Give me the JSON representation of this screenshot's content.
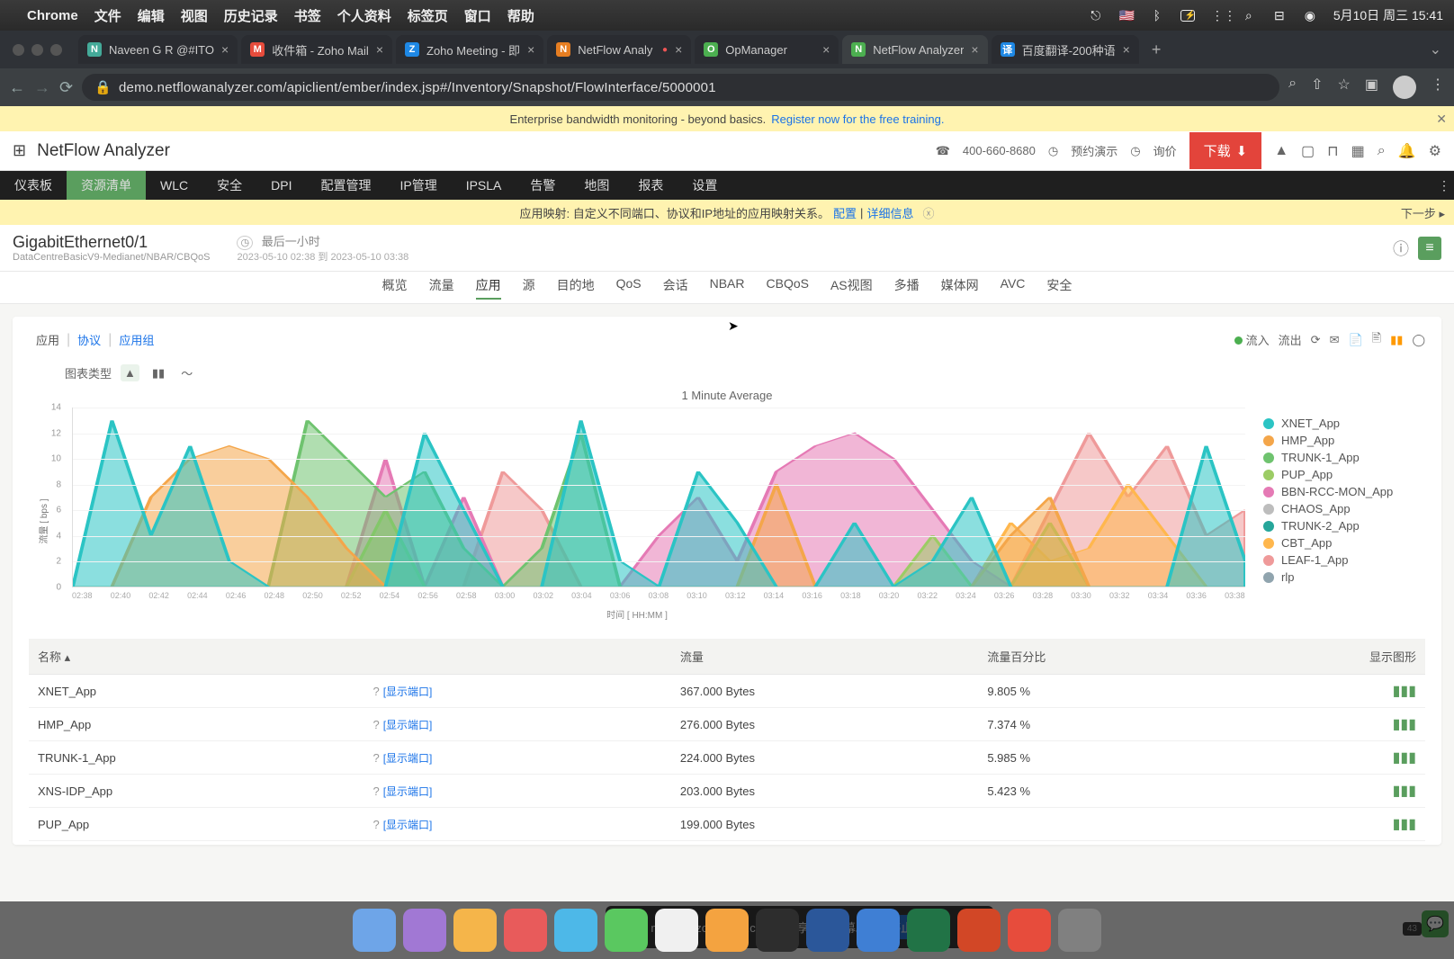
{
  "menubar": {
    "apple": "",
    "appname": "Chrome",
    "items": [
      "文件",
      "编辑",
      "视图",
      "历史记录",
      "书签",
      "个人资料",
      "标签页",
      "窗口",
      "帮助"
    ],
    "datetime": "5月10日 周三 15:41"
  },
  "tabs": [
    {
      "title": "Naveen G R @#ITO",
      "favi": "#4a9",
      "fl": "N"
    },
    {
      "title": "收件箱 - Zoho Mail",
      "favi": "#e74c3c",
      "fl": "M"
    },
    {
      "title": "Zoho Meeting - 即",
      "favi": "#1e88e5",
      "fl": "Z"
    },
    {
      "title": "NetFlow Analy",
      "favi": "#e67e22",
      "fl": "N",
      "rec": true
    },
    {
      "title": "OpManager",
      "favi": "#4caf50",
      "fl": "O"
    },
    {
      "title": "NetFlow Analyzer",
      "favi": "#4caf50",
      "fl": "N",
      "active": true
    },
    {
      "title": "百度翻译-200种语",
      "favi": "#1e88e5",
      "fl": "译"
    }
  ],
  "url": "demo.netflowanalyzer.com/apiclient/ember/index.jsp#/Inventory/Snapshot/FlowInterface/5000001",
  "banner1": {
    "text": "Enterprise bandwidth monitoring - beyond basics.",
    "link": "Register now for the free training."
  },
  "appheader": {
    "title": "NetFlow Analyzer",
    "phone": "400-660-8680",
    "demo": "预约演示",
    "quote": "询价",
    "download": "下载"
  },
  "topnav": [
    "仪表板",
    "资源清单",
    "WLC",
    "安全",
    "DPI",
    "配置管理",
    "IP管理",
    "IPSLA",
    "告警",
    "地图",
    "报表",
    "设置"
  ],
  "topnav_active": 1,
  "banner2": {
    "text": "应用映射: 自定义不同端口、协议和IP地址的应用映射关系。",
    "link1": "配置",
    "link2": "详细信息",
    "next": "下一步 ▸"
  },
  "interface": {
    "name": "GigabitEthernet0/1",
    "sub": "DataCentreBasicV9-Medianet/NBAR/CBQoS",
    "timelabel": "最后一小时",
    "range": "2023-05-10 02:38 到 2023-05-10 03:38"
  },
  "subnav": [
    "概览",
    "流量",
    "应用",
    "源",
    "目的地",
    "QoS",
    "会话",
    "NBAR",
    "CBQoS",
    "AS视图",
    "多播",
    "媒体网",
    "AVC",
    "安全"
  ],
  "subnav_active": 2,
  "filter": {
    "tabs": [
      "应用",
      "协议",
      "应用组"
    ],
    "in": "流入",
    "out": "流出"
  },
  "chart_type_label": "图表类型",
  "chart_data": {
    "type": "area",
    "title": "1 Minute Average",
    "xlabel": "时间 [ HH:MM ]",
    "ylabel": "流量 [ bps ]",
    "ylim": [
      0,
      14
    ],
    "yticks": [
      0,
      2,
      4,
      6,
      8,
      10,
      12,
      14
    ],
    "categories": [
      "02:38",
      "02:40",
      "02:42",
      "02:44",
      "02:46",
      "02:48",
      "02:50",
      "02:52",
      "02:54",
      "02:56",
      "02:58",
      "03:00",
      "03:02",
      "03:04",
      "03:06",
      "03:08",
      "03:10",
      "03:12",
      "03:14",
      "03:16",
      "03:18",
      "03:20",
      "03:22",
      "03:24",
      "03:26",
      "03:28",
      "03:30",
      "03:32",
      "03:34",
      "03:36",
      "03:38"
    ],
    "series": [
      {
        "name": "XNET_App",
        "color": "#2bc4c4",
        "values": [
          0,
          13,
          4,
          11,
          2,
          0,
          0,
          0,
          0,
          12,
          6,
          0,
          0,
          13,
          2,
          0,
          9,
          5,
          0,
          0,
          5,
          0,
          2,
          7,
          0,
          0,
          0,
          0,
          0,
          11,
          2
        ]
      },
      {
        "name": "HMP_App",
        "color": "#f4a64a",
        "values": [
          0,
          0,
          7,
          10,
          11,
          10,
          7,
          3,
          0,
          0,
          0,
          0,
          0,
          0,
          0,
          0,
          0,
          0,
          8,
          0,
          0,
          0,
          0,
          0,
          4,
          7,
          0,
          0,
          0,
          0,
          0
        ]
      },
      {
        "name": "TRUNK-1_App",
        "color": "#6fc36f",
        "values": [
          0,
          0,
          0,
          0,
          0,
          0,
          13,
          10,
          7,
          9,
          3,
          0,
          3,
          12,
          0,
          0,
          0,
          0,
          0,
          0,
          0,
          0,
          0,
          0,
          0,
          0,
          0,
          0,
          0,
          0,
          0
        ]
      },
      {
        "name": "PUP_App",
        "color": "#9ccc65",
        "values": [
          0,
          0,
          0,
          0,
          0,
          0,
          0,
          0,
          6,
          0,
          0,
          0,
          0,
          0,
          0,
          0,
          0,
          0,
          0,
          0,
          0,
          0,
          4,
          0,
          0,
          5,
          0,
          0,
          0,
          0,
          0
        ]
      },
      {
        "name": "BBN-RCC-MON_App",
        "color": "#e57ab5",
        "values": [
          0,
          0,
          0,
          0,
          0,
          0,
          0,
          0,
          10,
          0,
          7,
          0,
          0,
          0,
          0,
          4,
          7,
          2,
          9,
          11,
          12,
          10,
          6,
          2,
          0,
          0,
          0,
          0,
          0,
          0,
          0
        ]
      },
      {
        "name": "CHAOS_App",
        "color": "#bdbdbd",
        "values": [
          0,
          0,
          0,
          0,
          0,
          0,
          0,
          0,
          0,
          0,
          0,
          0,
          0,
          0,
          0,
          0,
          0,
          0,
          0,
          0,
          0,
          0,
          0,
          0,
          0,
          0,
          0,
          0,
          0,
          0,
          0
        ]
      },
      {
        "name": "TRUNK-2_App",
        "color": "#26a69a",
        "values": [
          0,
          0,
          0,
          0,
          0,
          0,
          0,
          0,
          0,
          0,
          0,
          0,
          0,
          0,
          0,
          0,
          0,
          0,
          0,
          0,
          0,
          0,
          0,
          0,
          0,
          0,
          0,
          0,
          0,
          0,
          0
        ]
      },
      {
        "name": "CBT_App",
        "color": "#ffb74d",
        "values": [
          0,
          0,
          0,
          0,
          0,
          0,
          0,
          0,
          0,
          0,
          0,
          0,
          0,
          0,
          0,
          0,
          0,
          0,
          0,
          0,
          0,
          0,
          0,
          0,
          5,
          2,
          3,
          8,
          4,
          0,
          0
        ]
      },
      {
        "name": "LEAF-1_App",
        "color": "#ef9a9a",
        "values": [
          0,
          0,
          0,
          0,
          0,
          0,
          0,
          0,
          0,
          0,
          0,
          9,
          6,
          0,
          0,
          0,
          0,
          0,
          0,
          0,
          0,
          0,
          0,
          0,
          0,
          6,
          12,
          7,
          11,
          4,
          6
        ]
      },
      {
        "name": "rlp",
        "color": "#90a4ae",
        "values": [
          0,
          0,
          0,
          0,
          0,
          0,
          0,
          0,
          0,
          0,
          0,
          0,
          0,
          0,
          0,
          0,
          0,
          0,
          0,
          0,
          0,
          0,
          0,
          0,
          0,
          0,
          0,
          0,
          0,
          0,
          0
        ]
      }
    ]
  },
  "table": {
    "headers": [
      "名称 ▴",
      "",
      "流量",
      "流量百分比",
      "显示图形"
    ],
    "portlabel": "[显示端口]",
    "rows": [
      {
        "name": "XNET_App",
        "traffic": "367.000 Bytes",
        "pct": "9.805 %"
      },
      {
        "name": "HMP_App",
        "traffic": "276.000 Bytes",
        "pct": "7.374 %"
      },
      {
        "name": "TRUNK-1_App",
        "traffic": "224.000 Bytes",
        "pct": "5.985 %"
      },
      {
        "name": "XNS-IDP_App",
        "traffic": "203.000 Bytes",
        "pct": "5.423 %"
      },
      {
        "name": "PUP_App",
        "traffic": "199.000 Bytes",
        "pct": ""
      }
    ]
  },
  "sharetoast": {
    "text": "meeting.zoho.com.cn正在共享您的屏幕。",
    "stop": "停止共享",
    "hide": "隐藏"
  },
  "pagecount": "43",
  "dock_colors": [
    "#6ea5e8",
    "#a178d4",
    "#f5b54a",
    "#e85b5b",
    "#4db8e8",
    "#5ac860",
    "#f0f0f0",
    "#f4a340",
    "#2d2d2d",
    "#2b579a",
    "#3f7fd4",
    "#217346",
    "#d24726",
    "#e74c3c",
    "#808080"
  ]
}
